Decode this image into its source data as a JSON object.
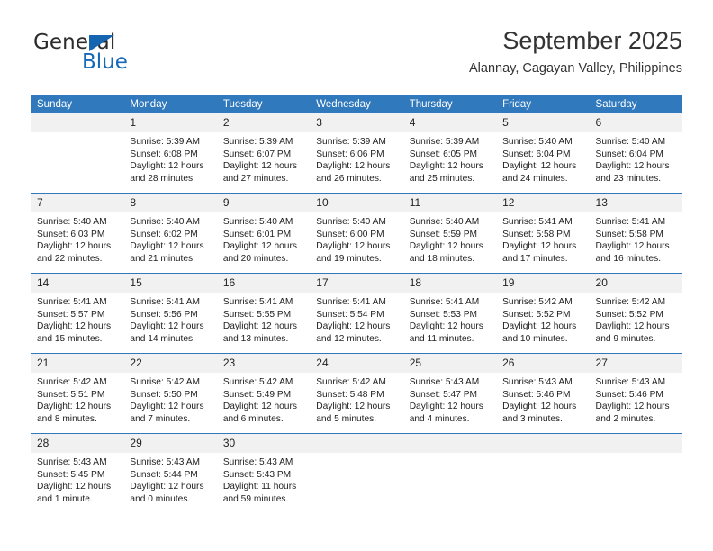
{
  "brand": {
    "name_top": "General",
    "name_bottom": "Blue",
    "triangle_color": "#1565b0",
    "blue_color": "#1569b8"
  },
  "header": {
    "title": "September 2025",
    "subtitle": "Alannay, Cagayan Valley, Philippines"
  },
  "theme": {
    "header_blue": "#3179bd",
    "daynum_bg": "#f1f1f1",
    "text": "#1e1e1e"
  },
  "weekdays": [
    "Sunday",
    "Monday",
    "Tuesday",
    "Wednesday",
    "Thursday",
    "Friday",
    "Saturday"
  ],
  "weeks": [
    [
      {
        "day": "",
        "empty": true,
        "sunrise": "",
        "sunset": "",
        "daylight_1": "",
        "daylight_2": ""
      },
      {
        "day": "1",
        "sunrise": "Sunrise: 5:39 AM",
        "sunset": "Sunset: 6:08 PM",
        "daylight_1": "Daylight: 12 hours",
        "daylight_2": "and 28 minutes."
      },
      {
        "day": "2",
        "sunrise": "Sunrise: 5:39 AM",
        "sunset": "Sunset: 6:07 PM",
        "daylight_1": "Daylight: 12 hours",
        "daylight_2": "and 27 minutes."
      },
      {
        "day": "3",
        "sunrise": "Sunrise: 5:39 AM",
        "sunset": "Sunset: 6:06 PM",
        "daylight_1": "Daylight: 12 hours",
        "daylight_2": "and 26 minutes."
      },
      {
        "day": "4",
        "sunrise": "Sunrise: 5:39 AM",
        "sunset": "Sunset: 6:05 PM",
        "daylight_1": "Daylight: 12 hours",
        "daylight_2": "and 25 minutes."
      },
      {
        "day": "5",
        "sunrise": "Sunrise: 5:40 AM",
        "sunset": "Sunset: 6:04 PM",
        "daylight_1": "Daylight: 12 hours",
        "daylight_2": "and 24 minutes."
      },
      {
        "day": "6",
        "sunrise": "Sunrise: 5:40 AM",
        "sunset": "Sunset: 6:04 PM",
        "daylight_1": "Daylight: 12 hours",
        "daylight_2": "and 23 minutes."
      }
    ],
    [
      {
        "day": "7",
        "sunrise": "Sunrise: 5:40 AM",
        "sunset": "Sunset: 6:03 PM",
        "daylight_1": "Daylight: 12 hours",
        "daylight_2": "and 22 minutes."
      },
      {
        "day": "8",
        "sunrise": "Sunrise: 5:40 AM",
        "sunset": "Sunset: 6:02 PM",
        "daylight_1": "Daylight: 12 hours",
        "daylight_2": "and 21 minutes."
      },
      {
        "day": "9",
        "sunrise": "Sunrise: 5:40 AM",
        "sunset": "Sunset: 6:01 PM",
        "daylight_1": "Daylight: 12 hours",
        "daylight_2": "and 20 minutes."
      },
      {
        "day": "10",
        "sunrise": "Sunrise: 5:40 AM",
        "sunset": "Sunset: 6:00 PM",
        "daylight_1": "Daylight: 12 hours",
        "daylight_2": "and 19 minutes."
      },
      {
        "day": "11",
        "sunrise": "Sunrise: 5:40 AM",
        "sunset": "Sunset: 5:59 PM",
        "daylight_1": "Daylight: 12 hours",
        "daylight_2": "and 18 minutes."
      },
      {
        "day": "12",
        "sunrise": "Sunrise: 5:41 AM",
        "sunset": "Sunset: 5:58 PM",
        "daylight_1": "Daylight: 12 hours",
        "daylight_2": "and 17 minutes."
      },
      {
        "day": "13",
        "sunrise": "Sunrise: 5:41 AM",
        "sunset": "Sunset: 5:58 PM",
        "daylight_1": "Daylight: 12 hours",
        "daylight_2": "and 16 minutes."
      }
    ],
    [
      {
        "day": "14",
        "sunrise": "Sunrise: 5:41 AM",
        "sunset": "Sunset: 5:57 PM",
        "daylight_1": "Daylight: 12 hours",
        "daylight_2": "and 15 minutes."
      },
      {
        "day": "15",
        "sunrise": "Sunrise: 5:41 AM",
        "sunset": "Sunset: 5:56 PM",
        "daylight_1": "Daylight: 12 hours",
        "daylight_2": "and 14 minutes."
      },
      {
        "day": "16",
        "sunrise": "Sunrise: 5:41 AM",
        "sunset": "Sunset: 5:55 PM",
        "daylight_1": "Daylight: 12 hours",
        "daylight_2": "and 13 minutes."
      },
      {
        "day": "17",
        "sunrise": "Sunrise: 5:41 AM",
        "sunset": "Sunset: 5:54 PM",
        "daylight_1": "Daylight: 12 hours",
        "daylight_2": "and 12 minutes."
      },
      {
        "day": "18",
        "sunrise": "Sunrise: 5:41 AM",
        "sunset": "Sunset: 5:53 PM",
        "daylight_1": "Daylight: 12 hours",
        "daylight_2": "and 11 minutes."
      },
      {
        "day": "19",
        "sunrise": "Sunrise: 5:42 AM",
        "sunset": "Sunset: 5:52 PM",
        "daylight_1": "Daylight: 12 hours",
        "daylight_2": "and 10 minutes."
      },
      {
        "day": "20",
        "sunrise": "Sunrise: 5:42 AM",
        "sunset": "Sunset: 5:52 PM",
        "daylight_1": "Daylight: 12 hours",
        "daylight_2": "and 9 minutes."
      }
    ],
    [
      {
        "day": "21",
        "sunrise": "Sunrise: 5:42 AM",
        "sunset": "Sunset: 5:51 PM",
        "daylight_1": "Daylight: 12 hours",
        "daylight_2": "and 8 minutes."
      },
      {
        "day": "22",
        "sunrise": "Sunrise: 5:42 AM",
        "sunset": "Sunset: 5:50 PM",
        "daylight_1": "Daylight: 12 hours",
        "daylight_2": "and 7 minutes."
      },
      {
        "day": "23",
        "sunrise": "Sunrise: 5:42 AM",
        "sunset": "Sunset: 5:49 PM",
        "daylight_1": "Daylight: 12 hours",
        "daylight_2": "and 6 minutes."
      },
      {
        "day": "24",
        "sunrise": "Sunrise: 5:42 AM",
        "sunset": "Sunset: 5:48 PM",
        "daylight_1": "Daylight: 12 hours",
        "daylight_2": "and 5 minutes."
      },
      {
        "day": "25",
        "sunrise": "Sunrise: 5:43 AM",
        "sunset": "Sunset: 5:47 PM",
        "daylight_1": "Daylight: 12 hours",
        "daylight_2": "and 4 minutes."
      },
      {
        "day": "26",
        "sunrise": "Sunrise: 5:43 AM",
        "sunset": "Sunset: 5:46 PM",
        "daylight_1": "Daylight: 12 hours",
        "daylight_2": "and 3 minutes."
      },
      {
        "day": "27",
        "sunrise": "Sunrise: 5:43 AM",
        "sunset": "Sunset: 5:46 PM",
        "daylight_1": "Daylight: 12 hours",
        "daylight_2": "and 2 minutes."
      }
    ],
    [
      {
        "day": "28",
        "sunrise": "Sunrise: 5:43 AM",
        "sunset": "Sunset: 5:45 PM",
        "daylight_1": "Daylight: 12 hours",
        "daylight_2": "and 1 minute."
      },
      {
        "day": "29",
        "sunrise": "Sunrise: 5:43 AM",
        "sunset": "Sunset: 5:44 PM",
        "daylight_1": "Daylight: 12 hours",
        "daylight_2": "and 0 minutes."
      },
      {
        "day": "30",
        "sunrise": "Sunrise: 5:43 AM",
        "sunset": "Sunset: 5:43 PM",
        "daylight_1": "Daylight: 11 hours",
        "daylight_2": "and 59 minutes."
      },
      {
        "day": "",
        "empty": true,
        "sunrise": "",
        "sunset": "",
        "daylight_1": "",
        "daylight_2": ""
      },
      {
        "day": "",
        "empty": true,
        "sunrise": "",
        "sunset": "",
        "daylight_1": "",
        "daylight_2": ""
      },
      {
        "day": "",
        "empty": true,
        "sunrise": "",
        "sunset": "",
        "daylight_1": "",
        "daylight_2": ""
      },
      {
        "day": "",
        "empty": true,
        "sunrise": "",
        "sunset": "",
        "daylight_1": "",
        "daylight_2": ""
      }
    ]
  ]
}
